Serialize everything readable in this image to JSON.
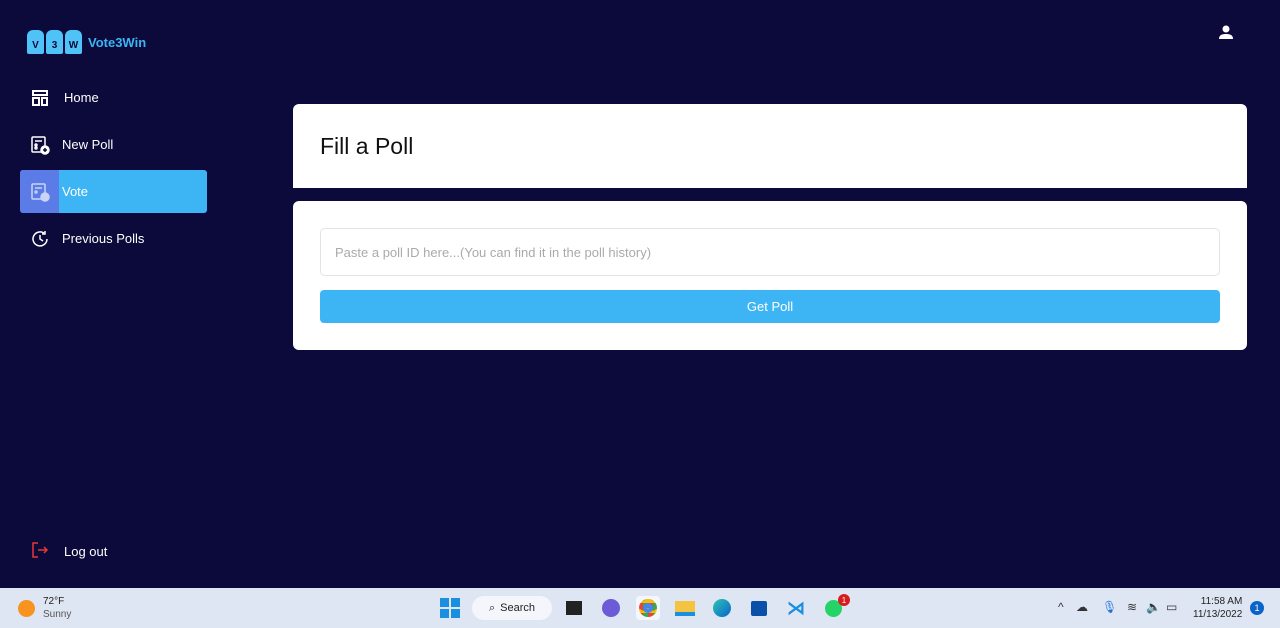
{
  "app": {
    "name": "Vote3Win",
    "logo_letters": [
      "V",
      "3",
      "W"
    ]
  },
  "sidebar": {
    "items": [
      {
        "label": "Home",
        "icon": "layout-icon",
        "active": false
      },
      {
        "label": "New Poll",
        "icon": "poll-add-icon",
        "active": false
      },
      {
        "label": "Vote",
        "icon": "poll-edit-icon",
        "active": true
      },
      {
        "label": "Previous Polls",
        "icon": "history-icon",
        "active": false
      }
    ],
    "logout_label": "Log out"
  },
  "header": {
    "profile_icon": "user-icon"
  },
  "main": {
    "title": "Fill a Poll",
    "input_placeholder": "Paste a poll ID here...(You can find it in the poll history)",
    "input_value": "",
    "button_label": "Get Poll"
  },
  "colors": {
    "background": "#0b0a3a",
    "accent": "#3db5f5",
    "active_icon_bg": "#5b7be6",
    "logout": "#e53935"
  },
  "taskbar": {
    "weather_temp": "72°F",
    "weather_desc": "Sunny",
    "search_label": "Search",
    "time": "11:58 AM",
    "date": "11/13/2022",
    "notification_count": "1",
    "whatsapp_badge": "1"
  }
}
